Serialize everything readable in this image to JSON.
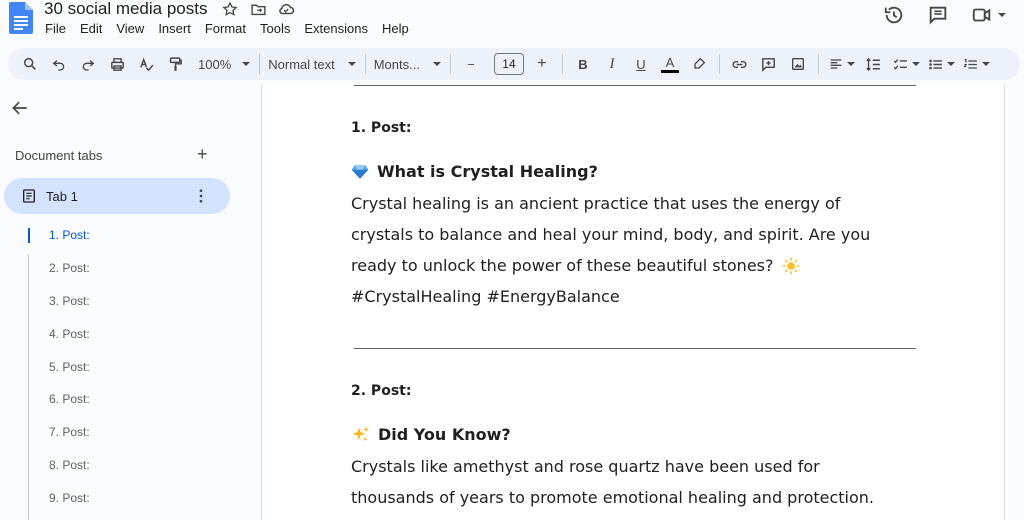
{
  "app": {
    "title": "30 social media posts",
    "menu": [
      "File",
      "Edit",
      "View",
      "Insert",
      "Format",
      "Tools",
      "Extensions",
      "Help"
    ],
    "brand_color": "#4285f4"
  },
  "toolbar": {
    "zoom": "100%",
    "style": "Normal text",
    "font": "Monts...",
    "font_size": "14",
    "bold_label": "B",
    "italic_label": "I",
    "underline_label": "U",
    "text_color_label": "A",
    "minus_label": "−",
    "plus_label": "+"
  },
  "sidebar": {
    "document_tabs_label": "Document tabs",
    "add_label": "+",
    "active_tab": "Tab 1",
    "outline": [
      "1. Post:",
      "2. Post:",
      "3. Post:",
      "4. Post:",
      "5. Post:",
      "6. Post:",
      "7. Post:",
      "8. Post:",
      "9. Post:"
    ],
    "active_index": 0,
    "accent": "#0b57d0",
    "active_bg": "#d3e3fd"
  },
  "document": {
    "posts": [
      {
        "heading": "1. Post:",
        "emoji_icon": "gem-icon",
        "subheading": "What is Crystal Healing?",
        "lines": [
          "Crystal healing is an ancient practice that uses the energy of",
          "crystals to balance and heal your mind, body, and spirit. Are you",
          "ready to unlock the power of these beautiful stones?",
          "#CrystalHealing #EnergyBalance"
        ],
        "trailing_icon": "sun-icon"
      },
      {
        "heading": "2. Post:",
        "emoji_icon": "sparkles-icon",
        "subheading": "Did You Know?",
        "lines": [
          "Crystals like amethyst and rose quartz have been used for",
          "thousands of years to promote emotional healing and protection."
        ]
      }
    ]
  }
}
